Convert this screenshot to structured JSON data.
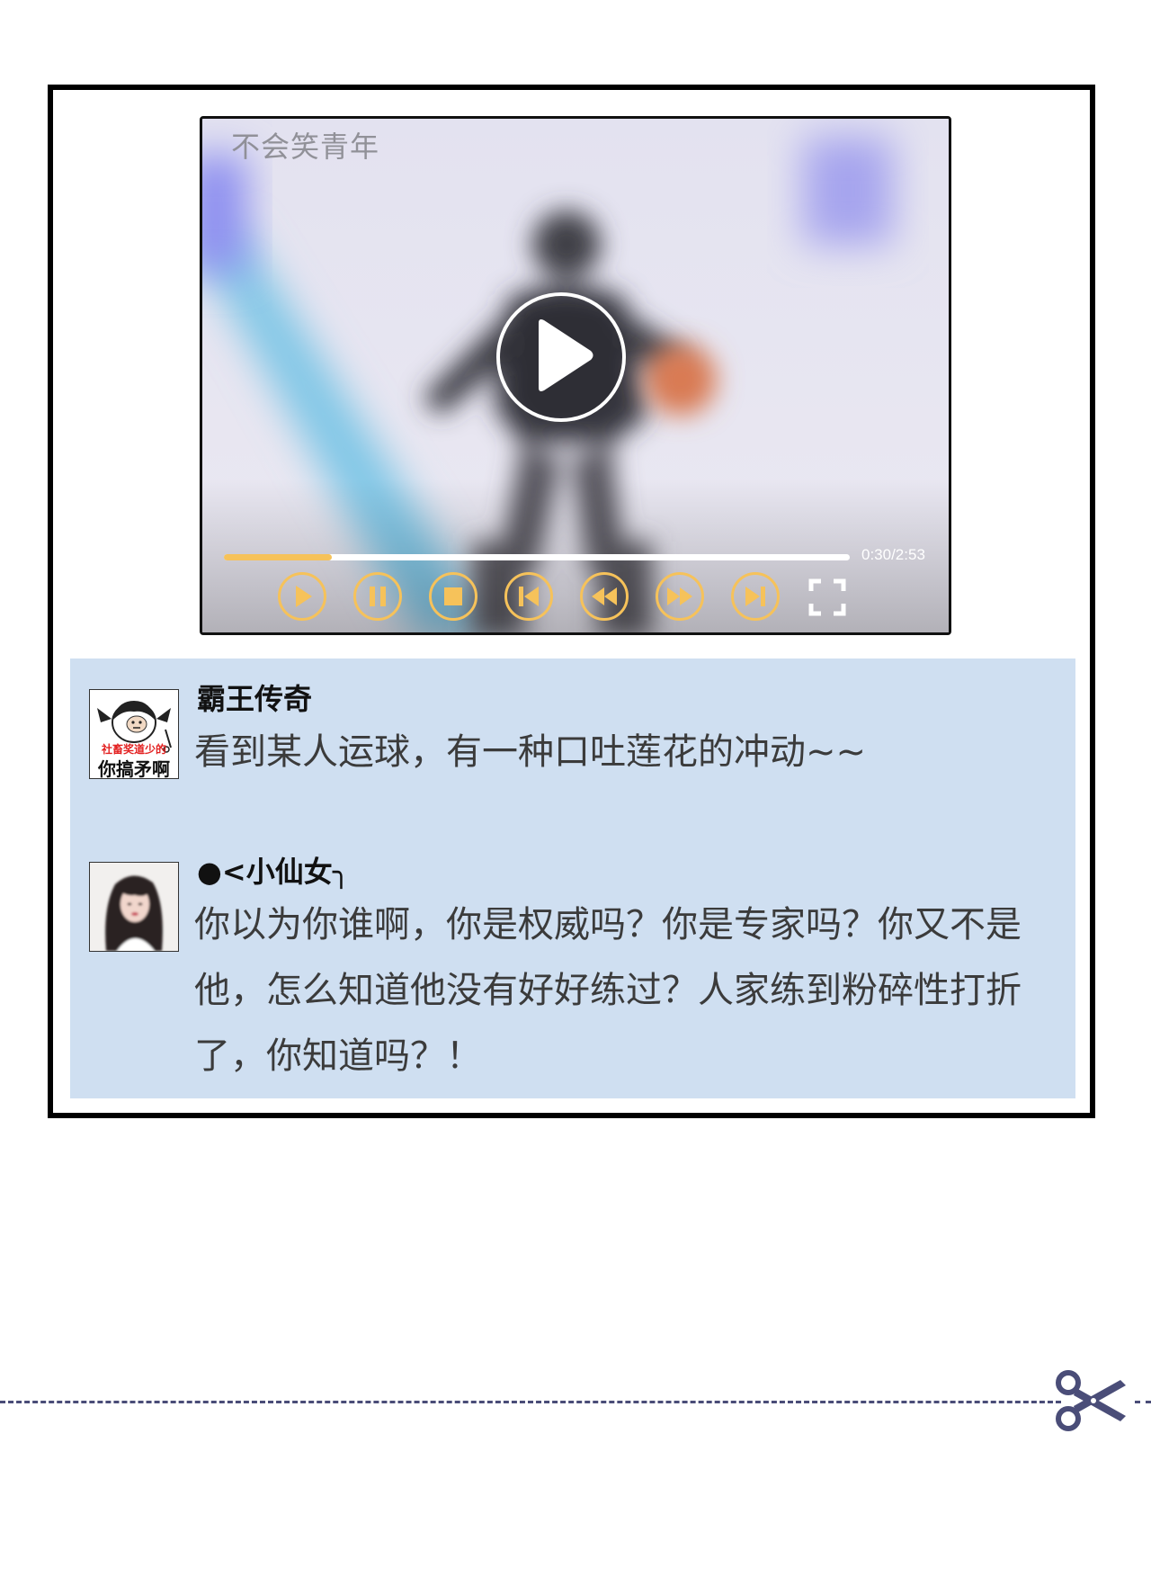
{
  "video": {
    "watermark": "不会笑青年",
    "elapsed": "0:30",
    "duration": "2:53",
    "time_display": "0:30/2:53",
    "progress": 0.173,
    "accent_color": "#f6c25a",
    "controls": [
      {
        "name": "play-icon"
      },
      {
        "name": "pause-icon"
      },
      {
        "name": "stop-icon"
      },
      {
        "name": "skip-back-icon"
      },
      {
        "name": "rewind-icon"
      },
      {
        "name": "fast-forward-icon"
      },
      {
        "name": "skip-forward-icon"
      },
      {
        "name": "fullscreen-icon"
      }
    ]
  },
  "comments": [
    {
      "username": "霸王传奇",
      "avatar": "meme-avatar",
      "avatar_caption_top": "社畜奖道少的",
      "avatar_caption_bottom": "你搞矛啊",
      "text": "看到某人运球，有一种口吐莲花的冲动~~"
    },
    {
      "username": "●<小仙女╮",
      "avatar": "girl-photo-avatar",
      "text": "你以为你谁啊，你是权威吗？你是专家吗？你又不是他，怎么知道他没有好好练过？人家练到粉碎性打折了，你知道吗？！"
    }
  ],
  "divider": {
    "icon": "scissors-icon",
    "color": "#4a4d78"
  },
  "colors": {
    "panel_background": "#cfdff1",
    "frame_border": "#000000"
  }
}
